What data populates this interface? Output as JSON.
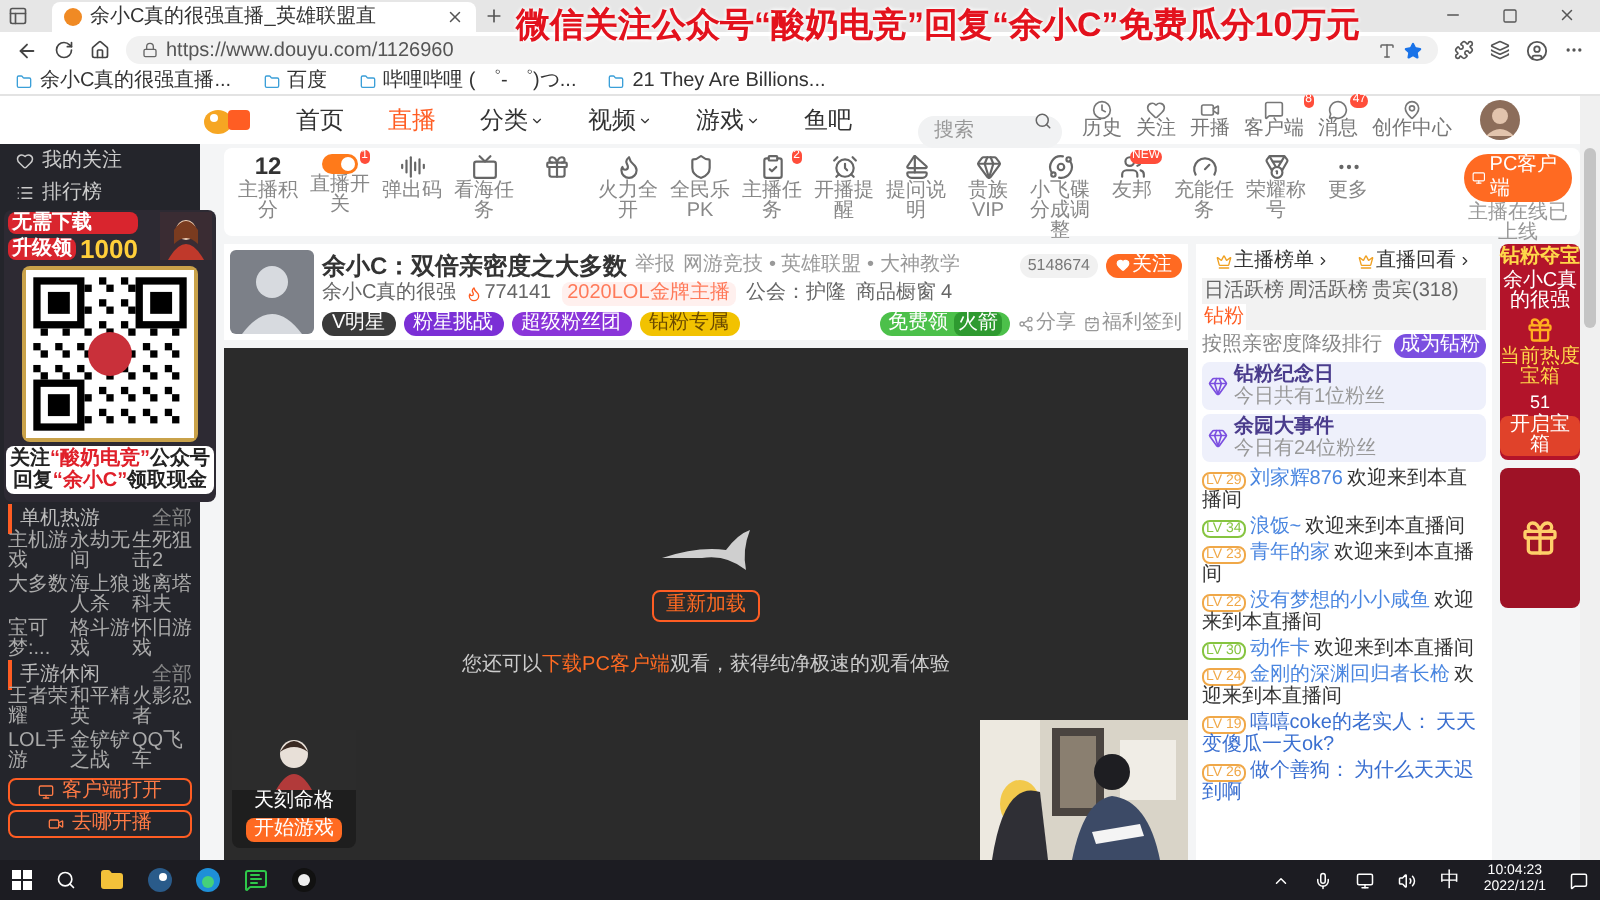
{
  "banner": "微信关注公众号“酸奶电竞”回复“余小C”免费瓜分10万元",
  "browser": {
    "tab_title": "余小C真的很强直播_英雄联盟直",
    "url": "https://www.douyu.com/1126960",
    "bookmarks": [
      "余小C真的很强直播...",
      "百度",
      "哔哩哔哩 ( ゜- ゜)つ...",
      "21 They Are Billions..."
    ]
  },
  "header": {
    "nav": [
      {
        "label": "首页",
        "selected": false,
        "menu": false
      },
      {
        "label": "直播",
        "selected": true,
        "menu": false
      },
      {
        "label": "分类",
        "selected": false,
        "menu": true
      },
      {
        "label": "视频",
        "selected": false,
        "menu": true
      },
      {
        "label": "游戏",
        "selected": false,
        "menu": true
      },
      {
        "label": "鱼吧",
        "selected": false,
        "menu": false
      }
    ],
    "search": {
      "placeholder": "搜索"
    },
    "actions": [
      {
        "label": "历史"
      },
      {
        "label": "关注"
      },
      {
        "label": "开播"
      },
      {
        "label": "客户端",
        "badge": "8"
      },
      {
        "label": "消息",
        "badge": "47"
      },
      {
        "label": "创作中心"
      }
    ]
  },
  "sidebar": {
    "items": [
      {
        "label": "我的关注"
      },
      {
        "label": "排行榜"
      }
    ],
    "sections": [
      {
        "title": "单机热游",
        "more": "全部",
        "games": [
          "主机游戏",
          "永劫无间",
          "生死狙击2",
          "大多数",
          "海上狼人杀",
          "逃离塔科夫",
          "宝可梦:...",
          "格斗游戏",
          "怀旧游戏"
        ]
      },
      {
        "title": "手游休闲",
        "more": "全部",
        "games": [
          "王者荣耀",
          "和平精英",
          "火影忍者",
          "LOL手游",
          "金铲铲之战",
          "QQ飞车"
        ]
      }
    ],
    "buttons": [
      {
        "label": "客户端打开"
      },
      {
        "label": "去哪开播"
      }
    ]
  },
  "ad": {
    "badge_lines": [
      "无需下载",
      "升级领"
    ],
    "amount": "1000",
    "lines": [
      [
        {
          "text": "关注",
          "highlight": false
        },
        {
          "text": "“酸奶电竞”",
          "highlight": true
        },
        {
          "text": "公众号",
          "highlight": false
        }
      ],
      [
        {
          "text": "回复",
          "highlight": false
        },
        {
          "text": "“余小C”",
          "highlight": true
        },
        {
          "text": "领取现金",
          "highlight": false
        }
      ]
    ]
  },
  "toolbar": [
    {
      "kind": "score",
      "value": "12",
      "label": "主播积分"
    },
    {
      "kind": "toggle",
      "label": "直播开关",
      "badge": "1"
    },
    {
      "kind": "wave",
      "label": "弹出码"
    },
    {
      "kind": "ad",
      "label": "看海任务"
    },
    {
      "kind": "gift"
    },
    {
      "kind": "fire",
      "label": "火力全开"
    },
    {
      "kind": "shield",
      "label": "全民乐PK"
    },
    {
      "kind": "task",
      "label": "主播任务",
      "badge": "2"
    },
    {
      "kind": "alarm",
      "label": "开播提醒"
    },
    {
      "kind": "boat",
      "label": "提问说明"
    },
    {
      "kind": "diamond",
      "label": "贵族VIP"
    },
    {
      "kind": "ufo",
      "label": "小飞碟分成调整"
    },
    {
      "kind": "friends",
      "label": "友邦",
      "badge": "NEW"
    },
    {
      "kind": "gauge",
      "label": "充能任务"
    },
    {
      "kind": "medal",
      "label": "荣耀称号"
    },
    {
      "kind": "more",
      "label": "更多"
    }
  ],
  "pc_client": {
    "label": "PC客户端",
    "note": "主播在线已上线"
  },
  "streamer": {
    "title": "余小C：双倍亲密度之大多数",
    "report": "举报",
    "category": "网游竞技 • 英雄联盟 • 大神教学",
    "anchor": "余小C真的很强",
    "heat": "774141",
    "honor": "2020LOL金牌主播",
    "guild": "公会：护隆",
    "shop": "商品橱窗 4",
    "followers": "5148674",
    "follow": "关注",
    "tags": [
      {
        "label": "V明星",
        "color": "#3a3a3a"
      },
      {
        "label": "粉星挑战",
        "color": "#7b2fd6"
      },
      {
        "label": "超级粉丝团",
        "color": "#8a35d9"
      },
      {
        "label": "钻粉专属",
        "color": "#f2c200"
      }
    ],
    "rocket": [
      "免费领",
      "火箭"
    ],
    "share": "分享",
    "checkin": "福利签到"
  },
  "video": {
    "reload": "重新加载",
    "hint": {
      "before": "您还可以",
      "link": "下载PC客户端",
      "after": "观看，获得纯净极速的观看体验"
    },
    "game_card": {
      "title": "天刻命格",
      "play": "开始游戏"
    }
  },
  "right_panel": {
    "links": [
      "主播榜单",
      "直播回看"
    ],
    "tabs": [
      {
        "label": "日活跃榜",
        "selected": false
      },
      {
        "label": "周活跃榜",
        "selected": false
      },
      {
        "label": "贵宾(318)",
        "selected": false
      },
      {
        "label": "钻粉",
        "selected": true
      }
    ],
    "rank_note": "按照亲密度降级排行",
    "join": "成为钻粉",
    "events": [
      {
        "title": "钻粉纪念日",
        "text": "今日共有1位粉丝"
      },
      {
        "title": "余园大事件",
        "text": "今日有24位粉丝"
      }
    ],
    "chat": [
      {
        "level": "LV 29",
        "color": "#f0a848",
        "kind": "welcome",
        "name": "刘家辉876",
        "text": "欢迎来到本直播间"
      },
      {
        "level": "LV 34",
        "color": "#86c440",
        "kind": "welcome",
        "name": "浪饭~",
        "text": "欢迎来到本直播间"
      },
      {
        "level": "LV 23",
        "color": "#f0a848",
        "kind": "welcome",
        "name": "青年的家",
        "text": "欢迎来到本直播间"
      },
      {
        "level": "LV 22",
        "color": "#f0a848",
        "kind": "welcome",
        "name": "没有梦想的小小咸鱼",
        "text": "欢迎来到本直播间"
      },
      {
        "level": "LV 30",
        "color": "#86c440",
        "kind": "welcome",
        "name": "动作卡",
        "text": "欢迎来到本直播间"
      },
      {
        "level": "LV 24",
        "color": "#f0a848",
        "kind": "welcome",
        "name": "金刚的深渊回归者长枪",
        "text": "欢迎来到本直播间"
      },
      {
        "level": "LV 19",
        "color": "#f0a848",
        "kind": "message",
        "name": "嘻嘻coke的老实人：",
        "text": "天天变傻瓜一天ok?"
      },
      {
        "level": "LV 26",
        "color": "#f0a848",
        "kind": "message",
        "name": "做个善狗：",
        "text": "为什么天天迟到啊"
      }
    ]
  },
  "ad_column": {
    "title": "钻粉夺宝",
    "anchor": "余小C真的很强",
    "box": "当前热度宝箱",
    "count": "51",
    "open": "开启宝箱"
  },
  "taskbar": {
    "ime": "中",
    "time": "10:04:23",
    "date": "2022/12/1"
  }
}
